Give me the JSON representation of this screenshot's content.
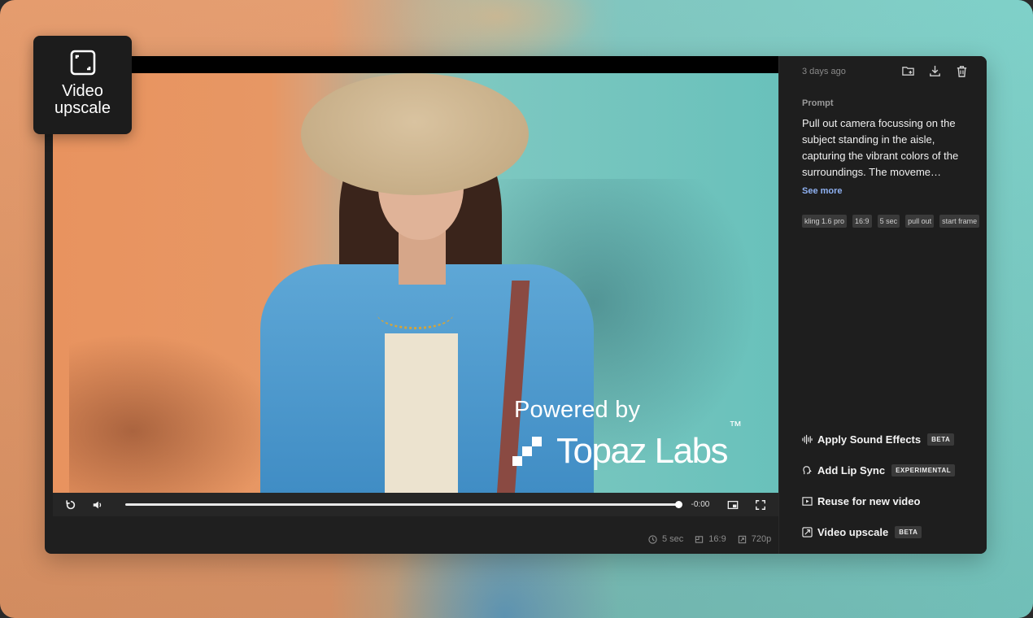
{
  "video": {
    "watermark_prefix": "Powered by",
    "watermark_brand": "Topaz Labs",
    "watermark_tm": "™"
  },
  "player": {
    "time_remaining": "-0:00",
    "progress": 1.0
  },
  "meta": {
    "duration": "5 sec",
    "aspect_ratio": "16:9",
    "resolution": "720p"
  },
  "sidebar": {
    "date": "3 days ago",
    "icons": [
      "add-to-folder-icon",
      "download-icon",
      "trash-icon"
    ],
    "prompt_label": "Prompt",
    "prompt_text": "Pull out camera focussing on the subject standing in the aisle, capturing the vibrant colors of the surroundings. The moveme…",
    "see_more": "See more",
    "tags": [
      "kling 1.6 pro",
      "16:9",
      "5 sec",
      "pull out",
      "start frame"
    ],
    "actions": [
      {
        "label": "Apply Sound Effects",
        "badge": "BETA",
        "icon": "waveform-icon"
      },
      {
        "label": "Add Lip Sync",
        "badge": "EXPERIMENTAL",
        "icon": "speaking-head-icon"
      },
      {
        "label": "Reuse for new video",
        "badge": "",
        "icon": "play-square-icon"
      },
      {
        "label": "Video upscale",
        "badge": "BETA",
        "icon": "upscale-icon"
      }
    ]
  },
  "card": {
    "label": "Video upscale",
    "icon": "upscale-icon"
  },
  "colors": {
    "panel_bg": "#1e1e1e",
    "link": "#8fb1f2",
    "tag_bg": "#3a3a3a"
  }
}
